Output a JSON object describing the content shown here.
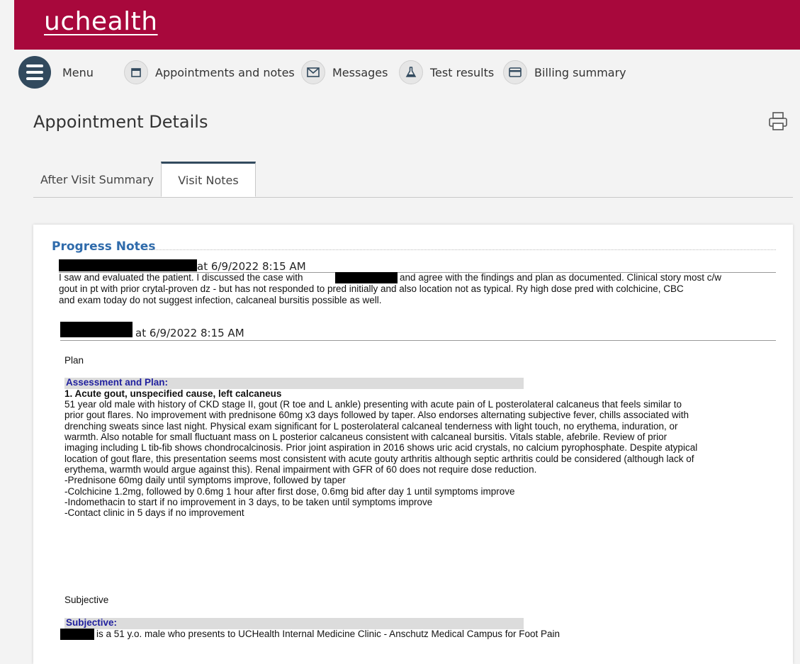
{
  "brand": {
    "logo_text": "uchealth",
    "color": "#a8083c"
  },
  "nav": {
    "menu_label": "Menu",
    "items": [
      {
        "label": "Appointments and notes",
        "icon": "calendar-icon"
      },
      {
        "label": "Messages",
        "icon": "envelope-icon"
      },
      {
        "label": "Test results",
        "icon": "flask-icon"
      },
      {
        "label": "Billing summary",
        "icon": "credit-card-icon"
      }
    ]
  },
  "page": {
    "title": "Appointment Details"
  },
  "tabs": [
    {
      "label": "After Visit Summary",
      "active": false
    },
    {
      "label": "Visit Notes",
      "active": true
    }
  ],
  "notes": {
    "heading": "Progress Notes",
    "note1": {
      "timestamp": "at 6/9/2022  8:15 AM",
      "text_a": "I saw and evaluated the patient. I discussed the case with",
      "text_b": "and agree with the findings and plan as documented. Clinical story most c/w",
      "text_c": "gout in pt with prior crytal-proven dz - but has not responded to pred initially and also location not as typical.  Ry high dose pred with colchicine, CBC",
      "text_d": "and exam today do not suggest infection, calcaneal bursitis possible as well."
    },
    "note2": {
      "timestamp": "at 6/9/2022  8:15 AM",
      "plan_label": "Plan",
      "ap_heading": "Assessment and Plan:",
      "dx_title": "1. Acute gout, unspecified cause, left calcaneus",
      "lines": [
        "51 year old male with history of CKD stage II, gout (R toe and L ankle) presenting with acute pain of L posterolateral calcaneus that feels similar to",
        "prior gout flares. No improvement with prednisone 60mg x3 days followed by taper. Also endorses alternating subjective fever, chills associated with",
        "drenching sweats since last night. Physical exam significant for L posterolateral calcaneal tenderness with light touch, no erythema, induration, or",
        "warmth. Also notable for small fluctuant mass on L posterior calcaneus consistent with calcaneal bursitis. Vitals stable, afebrile. Review of prior",
        "imaging including L tib-fib shows chondrocalcinosis. Prior joint aspiration in 2016 shows uric acid crystals, no calcium pyrophosphate. Despite atypical",
        "location of gout flare, this presentation seems most consistent with acute gouty arthritis although septic arthritis could be considered (although lack of",
        "erythema, warmth would argue against this). Renal impairment with GFR of 60 does not require dose reduction.",
        "-Prednisone 60mg daily until symptoms improve, followed by taper",
        "-Colchicine 1.2mg, followed by 0.6mg 1 hour after first dose, 0.6mg bid after day 1 until symptoms improve",
        "-Indomethacin to start if no improvement in 3 days, to be taken until symptoms improve",
        "-Contact clinic in 5 days if no improvement"
      ],
      "subjective_label": "Subjective",
      "subjective_heading": "Subjective:",
      "subjective_text": "is a 51 y.o. male who presents to UCHealth Internal Medicine Clinic - Anschutz Medical Campus for Foot Pain"
    }
  }
}
